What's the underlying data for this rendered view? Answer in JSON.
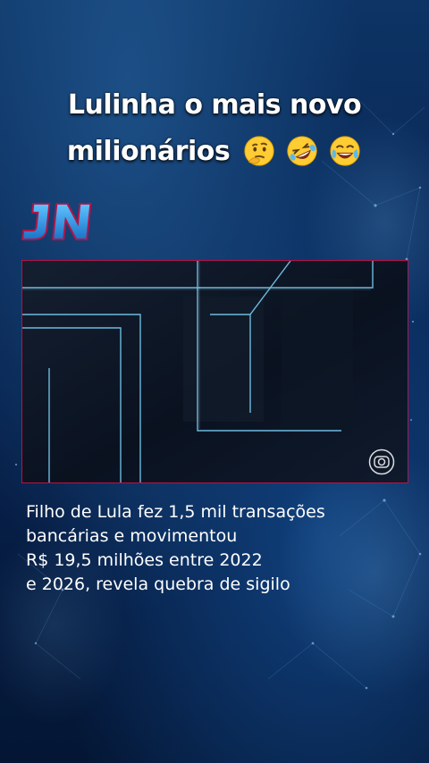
{
  "caption": {
    "line1": "Lulinha o mais novo",
    "line2": "milionários",
    "emojis": [
      "thinking-face-emoji",
      "rolling-laughing-emoji",
      "tears-of-joy-emoji"
    ]
  },
  "logo": {
    "text": "JN",
    "color": "#1f8fd6"
  },
  "video": {
    "border_color": "#b0154a",
    "watermark_icon": "globo-tv-icon"
  },
  "headline": {
    "lines": [
      "Filho de Lula fez 1,5 mil transações",
      "bancárias e movimentou",
      "R$ 19,5 milhões entre 2022",
      "e 2026, revela quebra de sigilo"
    ]
  }
}
